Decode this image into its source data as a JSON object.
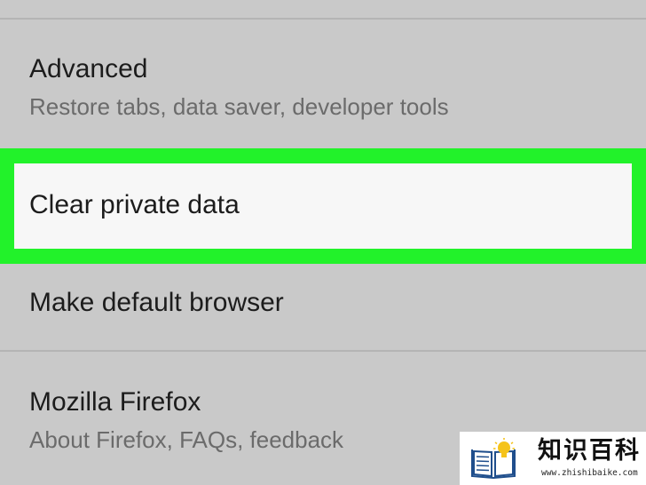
{
  "settings": {
    "items": [
      {
        "title": "Advanced",
        "subtitle": "Restore tabs, data saver, developer tools"
      },
      {
        "title": "Clear private data",
        "subtitle": ""
      },
      {
        "title": "Make default browser",
        "subtitle": ""
      },
      {
        "title": "Mozilla Firefox",
        "subtitle": "About Firefox, FAQs, feedback"
      }
    ],
    "highlight_color": "#22f22a"
  },
  "watermark": {
    "name": "知识百科",
    "url": "www.zhishibaike.com",
    "icon": "book-lightbulb-icon"
  }
}
